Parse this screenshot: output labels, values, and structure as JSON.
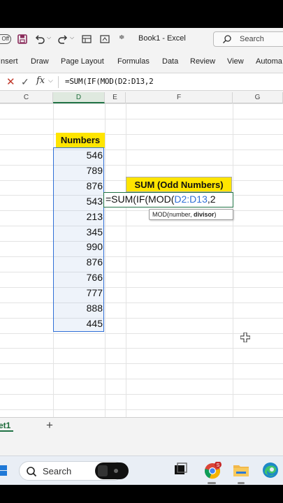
{
  "window": {
    "autosave_label": "Off",
    "title": "Book1  -  Excel",
    "search_label": "Search"
  },
  "ribbon": {
    "tabs": [
      "Insert",
      "Draw",
      "Page Layout",
      "Formulas",
      "Data",
      "Review",
      "View",
      "Automa"
    ]
  },
  "formula_bar": {
    "fx": "fx",
    "content": "=SUM(IF(MOD(D2:D13,2"
  },
  "columns": [
    "C",
    "D",
    "E",
    "F",
    "G"
  ],
  "sheet": {
    "header": "Numbers",
    "values": [
      "546",
      "789",
      "876",
      "543",
      "213",
      "345",
      "990",
      "876",
      "766",
      "777",
      "888",
      "445"
    ],
    "sum_label": "SUM (Odd Numbers)",
    "edit_prefix": "=SUM(IF(MOD(",
    "edit_ref": "D2:D13",
    "edit_suffix": ",2",
    "tooltip_fn": "MOD(number, ",
    "tooltip_arg": "divisor",
    "tooltip_end": ")"
  },
  "sheet_tabs": {
    "active": "et1",
    "add": "+"
  },
  "taskbar": {
    "search_label": "Search"
  },
  "colors": {
    "excel_green": "#217346",
    "highlight_yellow": "#ffe500",
    "selection_blue": "#2f6fd6"
  }
}
